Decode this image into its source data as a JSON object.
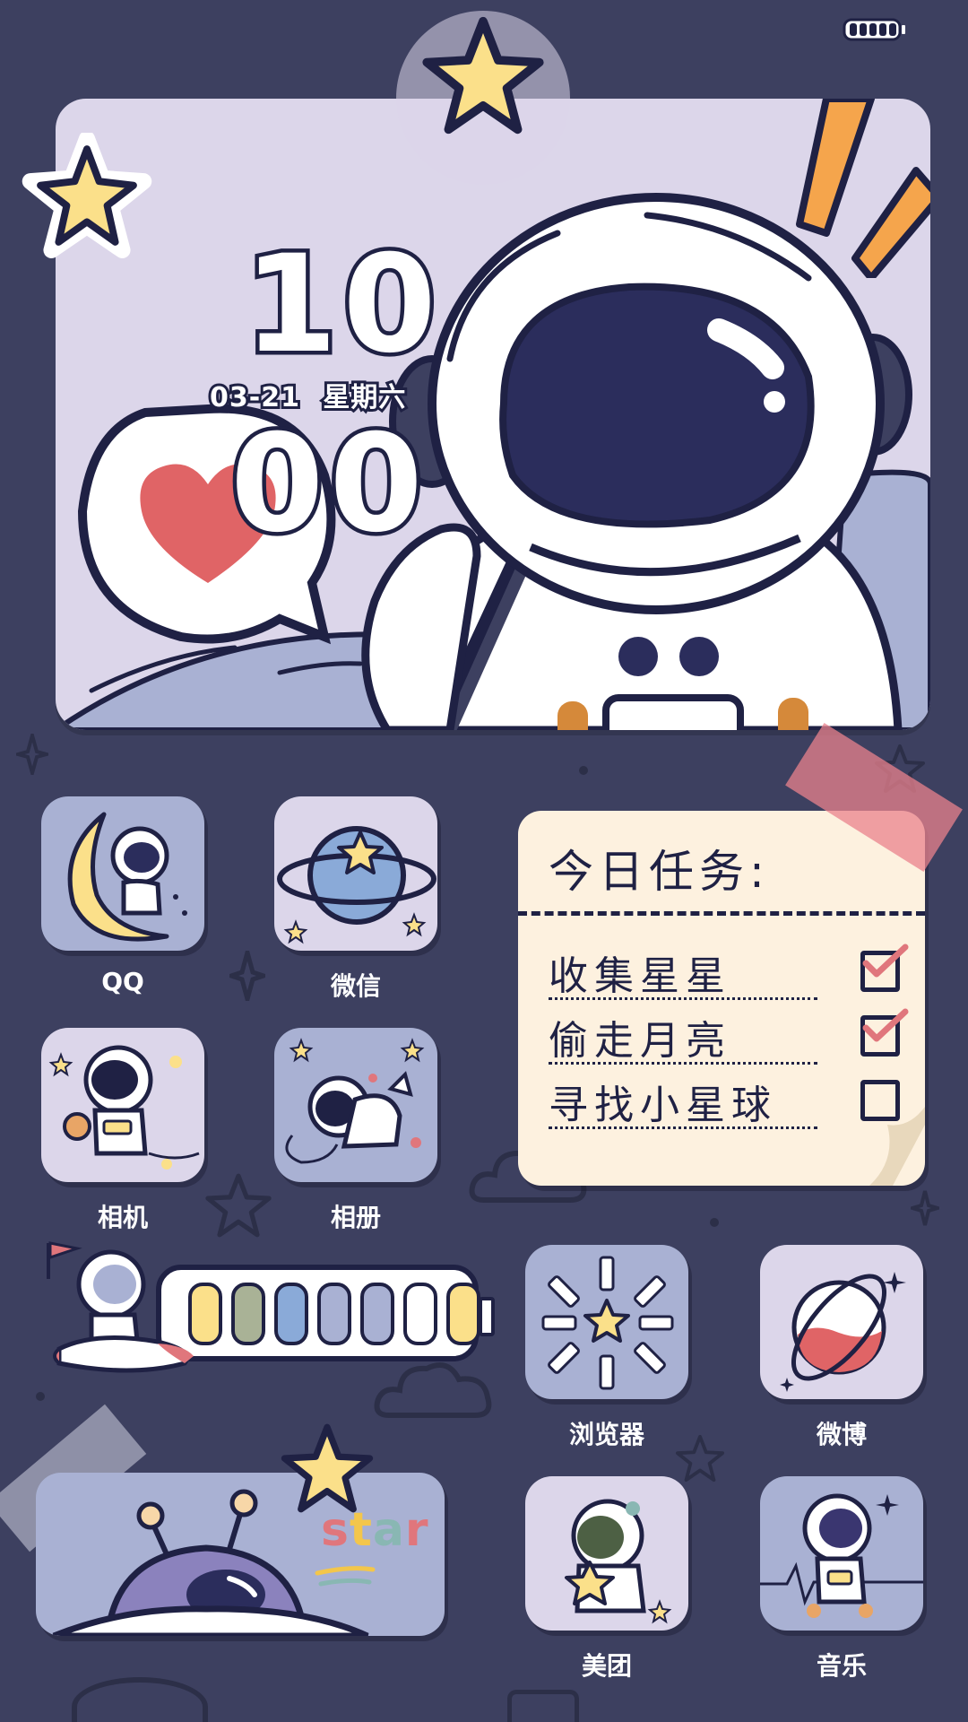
{
  "status_bar": {
    "battery_icon": "battery-icon"
  },
  "clock_widget": {
    "hours": "10",
    "minutes": "00",
    "date": "03-21",
    "weekday": "星期六"
  },
  "apps": [
    {
      "label": "QQ",
      "icon": "astronaut-on-moon-icon"
    },
    {
      "label": "微信",
      "icon": "planet-star-icon"
    },
    {
      "label": "相机",
      "icon": "astronaut-camera-icon"
    },
    {
      "label": "相册",
      "icon": "astronaut-dog-icon"
    },
    {
      "label": "浏览器",
      "icon": "sunburst-star-icon"
    },
    {
      "label": "微博",
      "icon": "planet-ring-icon"
    },
    {
      "label": "美团",
      "icon": "astronaut-hug-star-icon"
    },
    {
      "label": "音乐",
      "icon": "astronaut-dance-icon"
    }
  ],
  "todo": {
    "title": "今日任务:",
    "items": [
      {
        "text": "收集星星",
        "done": true
      },
      {
        "text": "偷走月亮",
        "done": true
      },
      {
        "text": "寻找小星球",
        "done": false
      }
    ]
  },
  "progress_widget": {
    "segments_total": 7,
    "segment_colors": [
      "#fbe08a",
      "#a9b296",
      "#8aaad8",
      "#a9b1d3",
      "#a9b1d3",
      "#ffffff",
      "#fbe08a"
    ]
  },
  "star_widget": {
    "word_letters": [
      "s",
      "t",
      "a",
      "r"
    ],
    "letter_colors": [
      "#e0767c",
      "#f3c64b",
      "#89b7b3",
      "#e0767c"
    ]
  },
  "colors": {
    "background": "#3d4060",
    "outline": "#1f2144",
    "lilac": "#dcd6ea",
    "blue_tile": "#a9b1d3",
    "star_yellow": "#fbe08a",
    "heart_red": "#e06466",
    "note_cream": "#fdf1df"
  }
}
